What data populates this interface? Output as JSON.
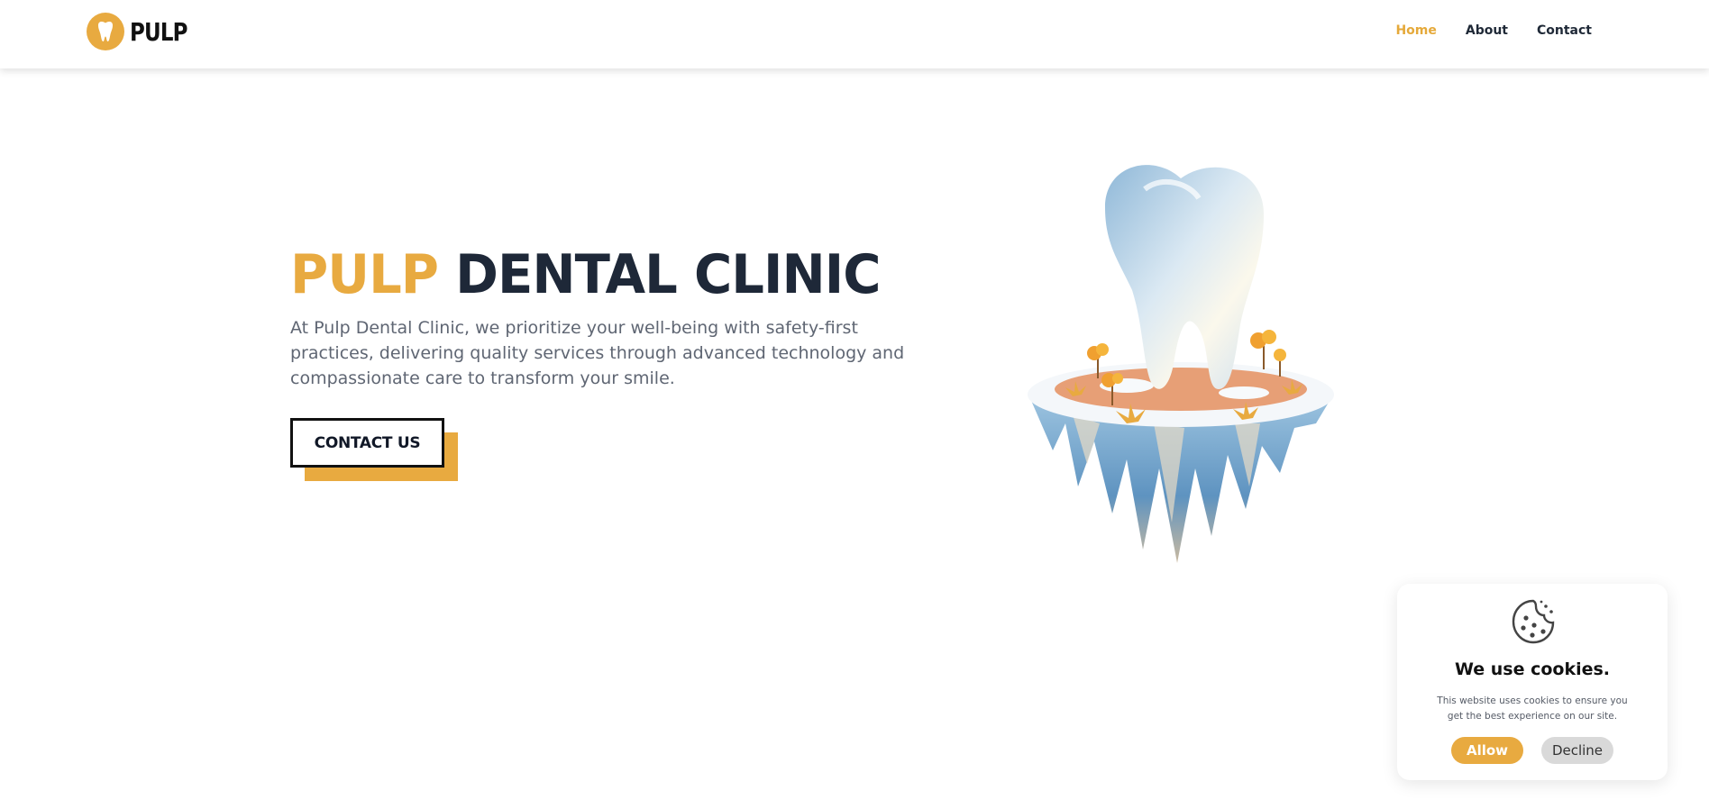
{
  "brand": {
    "name": "PULP",
    "logo_icon": "tooth-logo-icon"
  },
  "nav": {
    "home": "Home",
    "about": "About",
    "contact": "Contact",
    "active": "Home"
  },
  "hero": {
    "title_accent": "PULP",
    "title_rest": "DENTAL CLINIC",
    "description": "At Pulp Dental Clinic, we prioritize your well-being with safety-first practices, delivering quality services through advanced technology and compassionate care to transform your smile.",
    "cta_label": "CONTACT US",
    "image": "floating-island-tooth-illustration"
  },
  "cookie": {
    "icon": "cookie-icon",
    "title": "We use cookies.",
    "text": "This website uses cookies to ensure you get the best experience on our site.",
    "allow_label": "Allow",
    "decline_label": "Decline"
  },
  "colors": {
    "accent": "#e8aa40",
    "heading": "#1e2838",
    "body_text": "#5f6673",
    "decline_bg": "#d9d9d9"
  }
}
